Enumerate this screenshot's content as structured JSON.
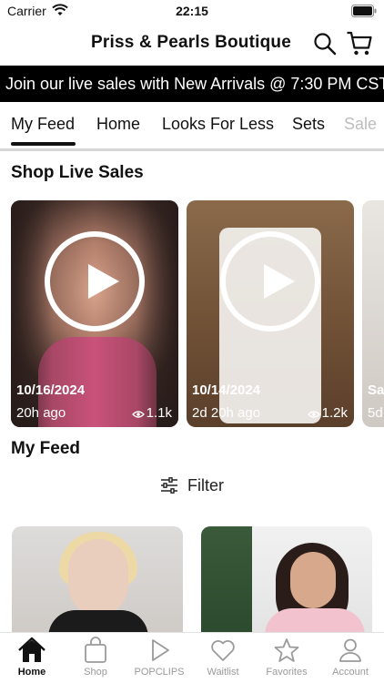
{
  "status_bar": {
    "carrier": "Carrier",
    "time": "22:15"
  },
  "header": {
    "title": "Priss & Pearls Boutique"
  },
  "banner": {
    "text": "Join our live sales with New Arrivals @ 7:30 PM CST!"
  },
  "tabs": [
    {
      "label": "My Feed",
      "active": true
    },
    {
      "label": "Home"
    },
    {
      "label": "Looks For Less"
    },
    {
      "label": "Sets"
    },
    {
      "label": "Sale"
    }
  ],
  "live_sales": {
    "title": "Shop Live Sales",
    "cards": [
      {
        "date": "10/16/2024",
        "ago": "20h ago",
        "views": "1.1k"
      },
      {
        "date": "10/14/2024",
        "ago": "2d 20h ago",
        "views": "1.2k"
      },
      {
        "date": "Sa",
        "ago": "5d"
      }
    ]
  },
  "feed": {
    "title": "My Feed",
    "filter_label": "Filter"
  },
  "tabbar": [
    {
      "label": "Home",
      "icon": "home-icon",
      "active": true
    },
    {
      "label": "Shop",
      "icon": "bag-icon"
    },
    {
      "label": "POPCLIPS",
      "icon": "play-icon"
    },
    {
      "label": "Waitlist",
      "icon": "heart-icon"
    },
    {
      "label": "Favorites",
      "icon": "star-icon"
    },
    {
      "label": "Account",
      "icon": "person-icon"
    }
  ],
  "colors": {
    "banner_bg": "#000000",
    "inactive_tab": "#9a9a9a",
    "divider": "#d6d6d6"
  }
}
